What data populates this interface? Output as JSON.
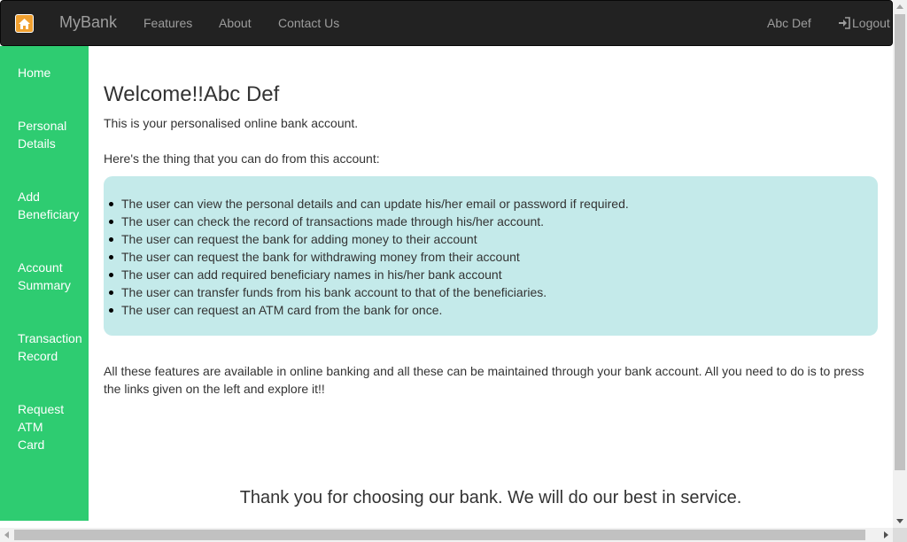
{
  "navbar": {
    "brand": "MyBank",
    "brand_icon": "home-icon",
    "links": [
      "Features",
      "About",
      "Contact Us"
    ],
    "user_name": "Abc Def",
    "logout_label": "Logout",
    "logout_icon": "log-in-icon"
  },
  "sidebar": {
    "items": [
      {
        "line1": "Home",
        "line2": "",
        "line3": ""
      },
      {
        "line1": "Personal",
        "line2": "Details",
        "line3": ""
      },
      {
        "line1": "Add",
        "line2": "Beneficiary",
        "line3": ""
      },
      {
        "line1": "Account",
        "line2": "Summary",
        "line3": ""
      },
      {
        "line1": "Transaction",
        "line2": "Record",
        "line3": ""
      },
      {
        "line1": "Request",
        "line2": "ATM",
        "line3": "Card"
      }
    ]
  },
  "main": {
    "title": "Welcome!!Abc Def",
    "intro": "This is your personalised online bank account.",
    "features_heading": "Here's the thing that you can do from this account:",
    "features": [
      "The user can view the personal details and can update his/her email or password if required.",
      "The user can check the record of transactions made through his/her account.",
      "The user can request the bank for adding money to their account",
      "The user can request the bank for withdrawing money from their account",
      "The user can add required beneficiary names in his/her bank account",
      "The user can transfer funds from his bank account to that of the beneficiaries.",
      "The user can request an ATM card from the bank for once."
    ],
    "closing": "All these features are available in online banking and all these can be maintained through your bank account. All you need to do is to press the links given on the left and explore it!!",
    "thanks": "Thank you for choosing our bank. We will do our best in service."
  },
  "colors": {
    "navbar_bg": "#222222",
    "sidebar_bg": "#2ecc71",
    "feature_box_bg": "#c4eaea",
    "nav_text": "#9d9d9d"
  }
}
